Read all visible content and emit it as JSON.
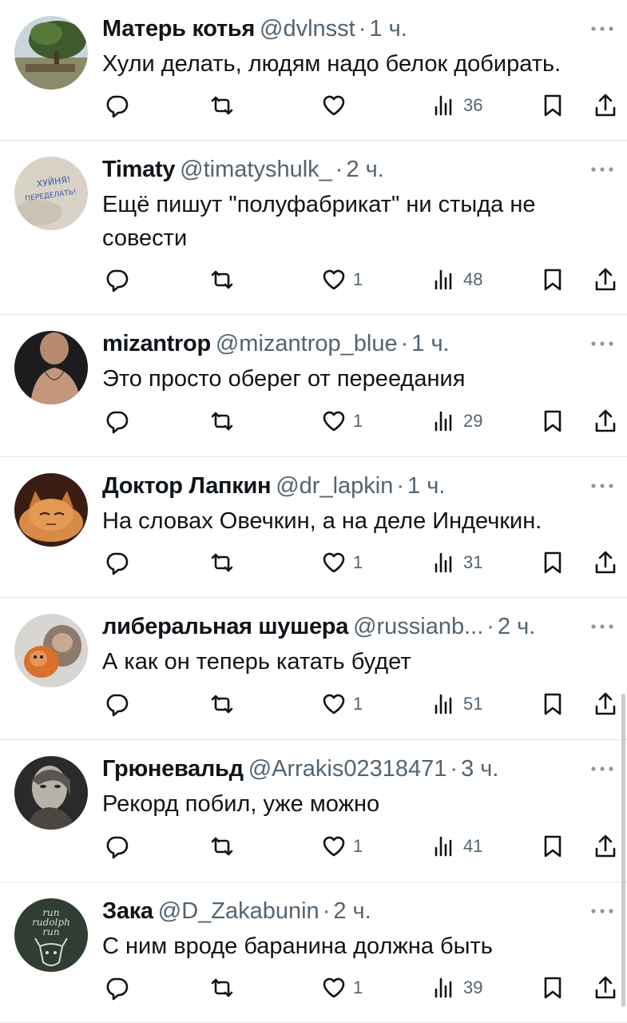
{
  "colors": {
    "text": "#0f1419",
    "secondary": "#536471",
    "divider": "#e3e7ea"
  },
  "icons": {
    "reply": "reply-icon",
    "retweet": "retweet-icon",
    "like": "heart-icon",
    "views": "views-icon",
    "bookmark": "bookmark-icon",
    "share": "share-icon",
    "more": "more-icon"
  },
  "tweets": [
    {
      "name": "Матерь котья",
      "handle": "@dvlnsst",
      "sep": "·",
      "time": "1 ч.",
      "text": "Хули делать, людям надо белок добирать.",
      "likes": "",
      "views": "36"
    },
    {
      "name": "Timaty",
      "handle": "@timatyshulk_",
      "sep": "·",
      "time": "2 ч.",
      "text": "Ещё пишут \"полуфабрикат\" ни стыда не совести",
      "likes": "1",
      "views": "48"
    },
    {
      "name": "mizantrop",
      "handle": "@mizantrop_blue",
      "sep": "·",
      "time": "1 ч.",
      "text": "Это просто оберег от переедания",
      "likes": "1",
      "views": "29"
    },
    {
      "name": "Доктор Лапкин",
      "handle": "@dr_lapkin",
      "sep": "·",
      "time": "1 ч.",
      "text": "На словах Овечкин, а на деле Индечкин.",
      "likes": "1",
      "views": "31"
    },
    {
      "name": "либеральная шушера",
      "handle": "@russianb...",
      "sep": "·",
      "time": "2 ч.",
      "text": "А как он теперь катать будет",
      "likes": "1",
      "views": "51"
    },
    {
      "name": "Грюневальд",
      "handle": "@Arrakis02318471",
      "sep": "·",
      "time": "3 ч.",
      "text": "Рекорд побил, уже можно",
      "likes": "1",
      "views": "41"
    },
    {
      "name": "Зака",
      "handle": "@D_Zakabunin",
      "sep": "·",
      "time": "2 ч.",
      "text": "С ним вроде баранина должна быть",
      "likes": "1",
      "views": "39"
    }
  ],
  "avatar_texts": {
    "timaty": [
      "ХУЙНЯ!",
      "ПЕРЕДЕЛАТЬ!"
    ],
    "zaka": [
      "run",
      "rudolph",
      "run"
    ]
  }
}
